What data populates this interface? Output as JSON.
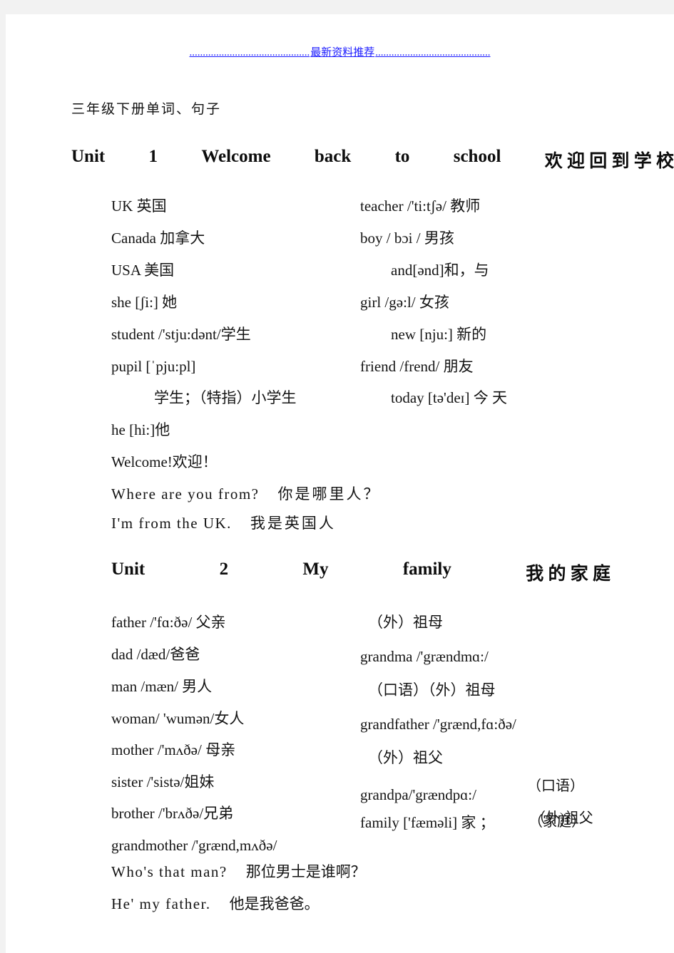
{
  "header": {
    "watermark_text": "最新资料推荐",
    "dots_left": ".............................................",
    "dots_right": "...........................................",
    "color": "#1a1aff"
  },
  "document": {
    "title": "三年级下册单词、句子"
  },
  "units": [
    {
      "heading": {
        "unit_label": "Unit",
        "number": "1",
        "title_en_1": "Welcome",
        "title_en_2": "back",
        "title_en_3": "to",
        "title_en_4": "school",
        "title_cn": "欢 迎 回 到 学 校"
      },
      "left_column": [
        "UK  英国",
        "Canada  加拿大",
        "USA  美国",
        "she   [ʃi:]  她",
        "student  /'stju:dənt/学生",
        "pupil   [ˈpju:pl]",
        "学生；（特指）小学生"
      ],
      "right_column": [
        "teacher  /'ti:tʃə/ 教师",
        "boy /  bɔi /  男孩",
        "and[ənd]和，与",
        "girl  /gə:l/  女孩",
        "new  [nju:]    新的",
        "friend  /frend/  朋友",
        "today  [tə'deɪ]     今    天"
      ],
      "tail_lines": [
        "he  [hi:]他",
        "Welcome!欢迎！"
      ],
      "sentences": [
        {
          "en": "Where are you from?",
          "cn": "你是哪里人？"
        },
        {
          "en": "I'm from the UK.",
          "cn": "我是英国人"
        }
      ]
    },
    {
      "heading": {
        "unit_label": "Unit",
        "number": "2",
        "title_en_1": "My",
        "title_en_2": "family",
        "title_cn": "我   的   家   庭"
      },
      "left_column": [
        "father /'fɑ:ðə/ 父亲",
        "dad /dæd/爸爸",
        "man /mæn/ 男人",
        "woman/ 'wumən/女人",
        "mother /'mʌðə/ 母亲",
        "sister /'sistə/姐妹",
        "brother /'brʌðə/兄弟",
        "grandmother /'grænd,mʌðə/"
      ],
      "right_column": [
        "（外）祖母",
        "grandma /'grændmɑ:/",
        "（口语）（外）祖母",
        "grandfather  /'grænd,fɑ:ðə/",
        "（外）祖父",
        "grandpa/'grændpɑ:/",
        "family ['fæməli] 家 ；"
      ],
      "overlay": {
        "spoken_label": "（口语）",
        "grandfather_cn": "（外)祖父",
        "family_cn": "（家庭）"
      },
      "sentences": [
        {
          "en": "Who's that man?",
          "cn": "那位男士是谁啊？"
        },
        {
          "en": "He' my father.",
          "cn": "他是我爸爸。"
        }
      ]
    }
  ]
}
